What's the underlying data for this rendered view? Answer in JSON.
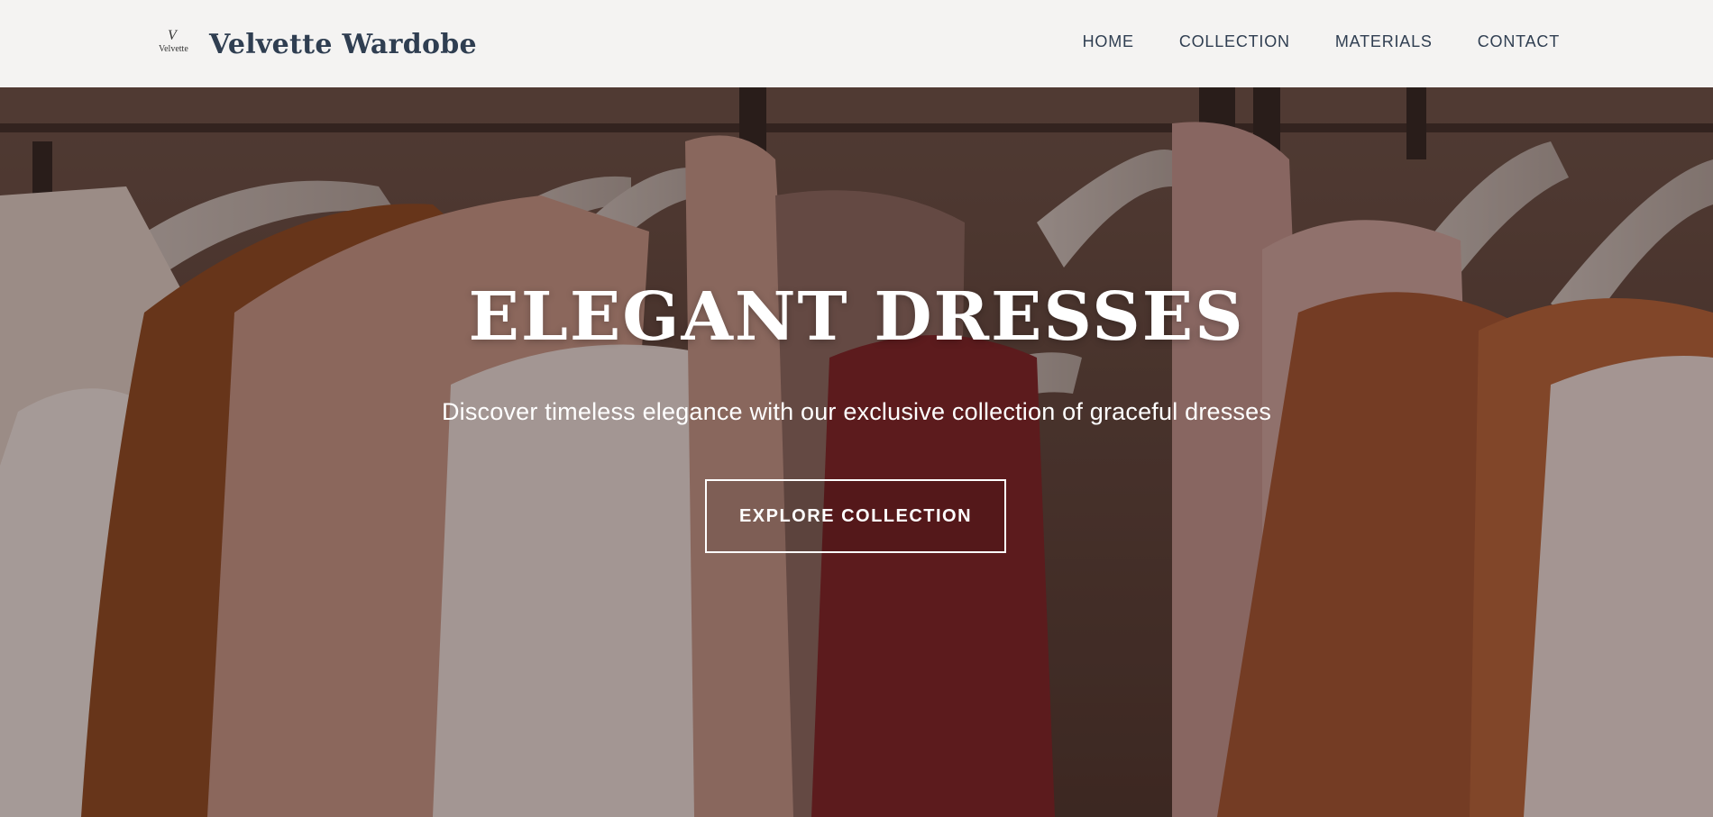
{
  "header": {
    "logo": {
      "monogram": "V",
      "wordmark": "Velvette"
    },
    "brand_name": "Velvette Wardobe",
    "nav": [
      {
        "label": "HOME"
      },
      {
        "label": "COLLECTION"
      },
      {
        "label": "MATERIALS"
      },
      {
        "label": "CONTACT"
      }
    ]
  },
  "hero": {
    "title": "ELEGANT DRESSES",
    "subtitle": "Discover timeless elegance with our exclusive collection of graceful dresses",
    "cta_label": "EXPLORE COLLECTION",
    "background_image": "clothes-on-hangers-photo"
  },
  "colors": {
    "header_bg": "#f4f3f2",
    "brand_text": "#2f3e51",
    "hero_text": "#ffffff",
    "overlay": "rgba(40,22,18,0.38)"
  }
}
